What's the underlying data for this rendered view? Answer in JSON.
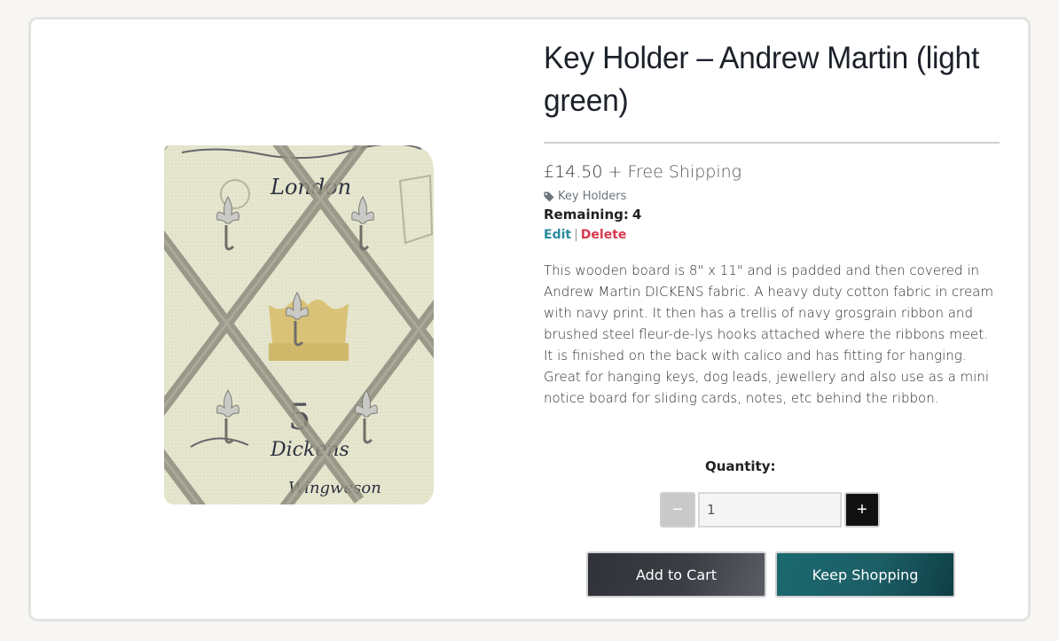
{
  "product": {
    "title": "Key Holder – Andrew Martin (light green)",
    "price": "£14.50",
    "shipping": "+ Free Shipping",
    "category": "Key Holders",
    "remaining_label": "Remaining:",
    "remaining_value": "4",
    "edit_label": "Edit",
    "separator": "|",
    "delete_label": "Delete",
    "description": "This wooden board is 8\" x 11\" and is padded and then covered in Andrew Martin DICKENS fabric. A heavy duty cotton fabric in cream with navy print. It then has a trellis of navy grosgrain ribbon and brushed steel fleur-de-lys hooks attached where the ribbons meet. It is finished on the back with calico and has fitting for hanging. Great for hanging keys, dog leads, jewellery and also use as a mini notice board for sliding cards, notes, etc behind the ribbon."
  },
  "image_text": {
    "line1": "London",
    "line2": "5",
    "line3": "Dickens",
    "line4": "Wingweson"
  },
  "quantity": {
    "label": "Quantity:",
    "value": "1",
    "minus_label": "−",
    "plus_label": "+"
  },
  "buttons": {
    "add_to_cart": "Add to Cart",
    "keep_shopping": "Keep Shopping"
  },
  "colors": {
    "edit": "#2a8a9e",
    "delete": "#d9384f",
    "keep_shopping_bg": "#1b6970",
    "add_to_cart_bg": "#2f3238"
  },
  "icons": {
    "category": "tag-icon"
  }
}
